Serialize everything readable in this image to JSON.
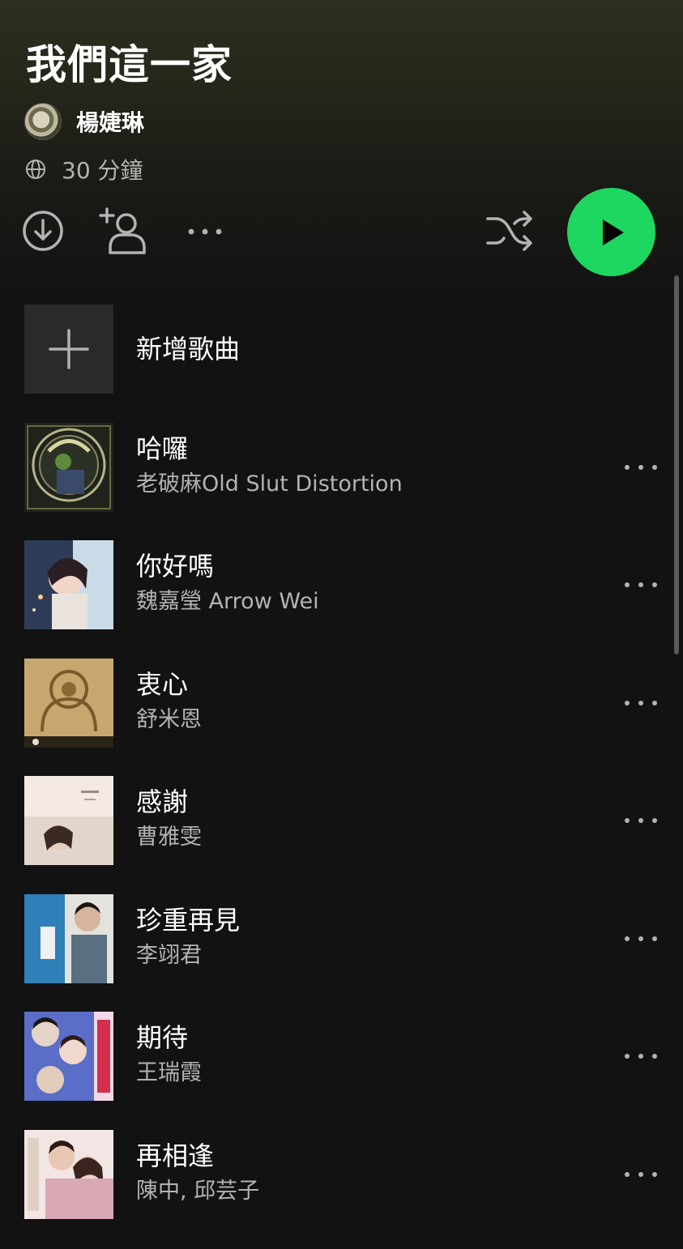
{
  "playlist": {
    "title": "我們這一家",
    "owner": "楊婕琳",
    "duration": "30 分鐘"
  },
  "actions": {
    "download_icon": "download-circle-icon",
    "add_user_icon": "add-user-icon",
    "more_icon": "more-icon",
    "shuffle_icon": "shuffle-icon",
    "play_icon": "play-icon"
  },
  "add_song": {
    "label": "新增歌曲",
    "icon": "plus-icon"
  },
  "tracks": [
    {
      "title": "哈囉",
      "artist": "老破麻Old Slut Distortion"
    },
    {
      "title": "你好嗎",
      "artist": "魏嘉瑩 Arrow Wei"
    },
    {
      "title": "衷心",
      "artist": "舒米恩"
    },
    {
      "title": "感謝",
      "artist": "曹雅雯"
    },
    {
      "title": "珍重再見",
      "artist": "李翊君"
    },
    {
      "title": "期待",
      "artist": "王瑞霞"
    },
    {
      "title": "再相逢",
      "artist": "陳中, 邱芸子"
    }
  ],
  "colors": {
    "accent": "#1ed760",
    "background": "#121212",
    "secondary_text": "#b3b3b3"
  }
}
